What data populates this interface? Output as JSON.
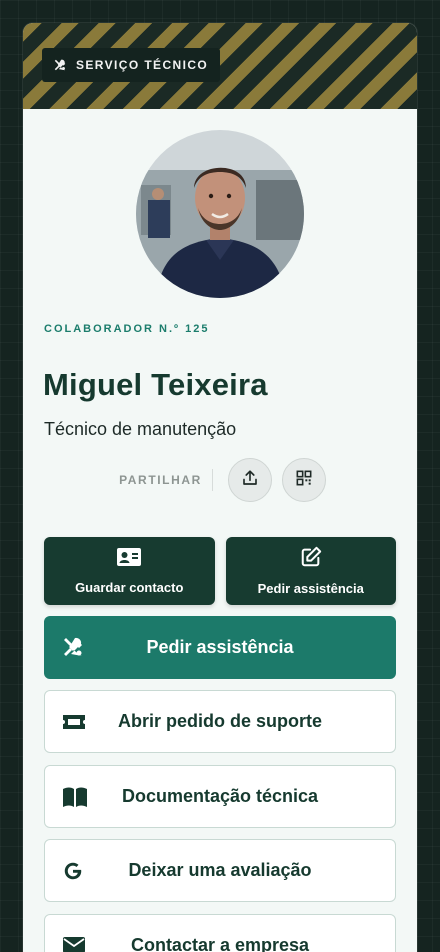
{
  "banner": {
    "badge_label": "SERVIÇO TÉCNICO",
    "badge_icon": "tools-icon"
  },
  "profile": {
    "employee_number": "COLABORADOR N.º 125",
    "name": "Miguel Teixeira",
    "role": "Técnico de manutenção"
  },
  "share": {
    "label": "PARTILHAR",
    "icons": [
      "upload-icon",
      "qr-code-icon"
    ]
  },
  "tiles": [
    {
      "label": "Guardar contacto",
      "icon": "contact-card-icon"
    },
    {
      "label": "Pedir assistência",
      "icon": "edit-icon"
    }
  ],
  "primary_action": {
    "label": "Pedir assistência",
    "icon": "tools-icon"
  },
  "links": [
    {
      "label": "Abrir pedido de suporte",
      "icon": "ticket-icon"
    },
    {
      "label": "Documentação técnica",
      "icon": "book-icon"
    },
    {
      "label": "Deixar uma avaliação",
      "icon": "google-icon"
    },
    {
      "label": "Contactar a empresa",
      "icon": "envelope-icon"
    }
  ],
  "colors": {
    "dark_green": "#173b30",
    "accent_teal": "#1c7a6a",
    "background": "#152420",
    "stripe_gold": "#8a7a3a"
  }
}
